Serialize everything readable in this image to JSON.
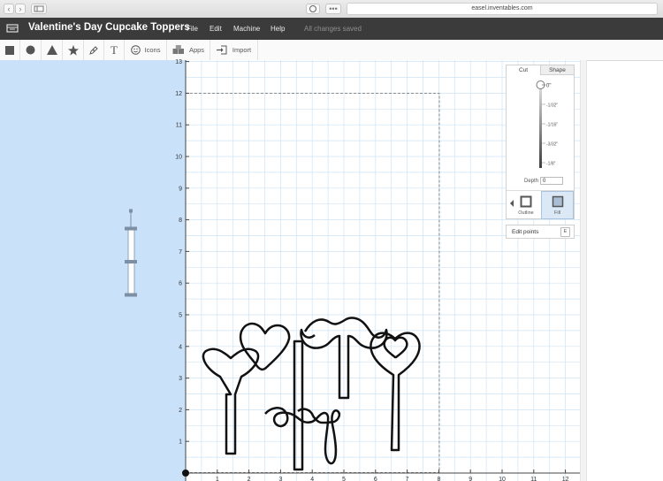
{
  "browser": {
    "url": "easel.inventables.com",
    "ext_icon": "pinterest-icon",
    "dots": "•••",
    "back_glyph": "‹",
    "forward_glyph": "›"
  },
  "app": {
    "title": "Valentine's Day Cupcake Toppers",
    "logo_icon": "easel-logo-icon",
    "menu": [
      "File",
      "Edit",
      "Machine",
      "Help"
    ],
    "save_status": "All changes saved"
  },
  "toolbar": {
    "icons_label": "Icons",
    "apps_label": "Apps",
    "import_label": "Import",
    "text_glyph": "T",
    "tools": [
      "square-icon",
      "circle-icon",
      "triangle-icon",
      "star-icon",
      "pen-icon",
      "text-icon",
      "smiley-icon",
      "cubes-icon",
      "import-icon"
    ]
  },
  "canvas": {
    "y_ticks": [
      "1",
      "2",
      "3",
      "4",
      "5",
      "6",
      "7",
      "8",
      "9",
      "10",
      "11",
      "12",
      "13"
    ],
    "x_ticks": [
      "1",
      "2",
      "3",
      "4",
      "5",
      "6",
      "7",
      "8",
      "9",
      "10",
      "11",
      "12"
    ],
    "material_width": 8,
    "material_height": 12
  },
  "cut_panel": {
    "tab_cut": "Cut",
    "tab_shape": "Shape",
    "depth_marks": [
      "0\"",
      "-1/32\"",
      "-1/16\"",
      "-3/32\"",
      "-1/8\""
    ],
    "depth_label": "Depth",
    "depth_value": "0",
    "outline_label": "Outline",
    "fill_label": "Fill",
    "edit_points_label": "Edit points",
    "edit_points_key": "E"
  },
  "colors": {
    "header_bg": "#3b3b3b",
    "left_panel": "#c9e1f9",
    "grid_line": "#cfe3f5",
    "selection": "#7d8fa3",
    "accent": "#6a8fb3"
  }
}
